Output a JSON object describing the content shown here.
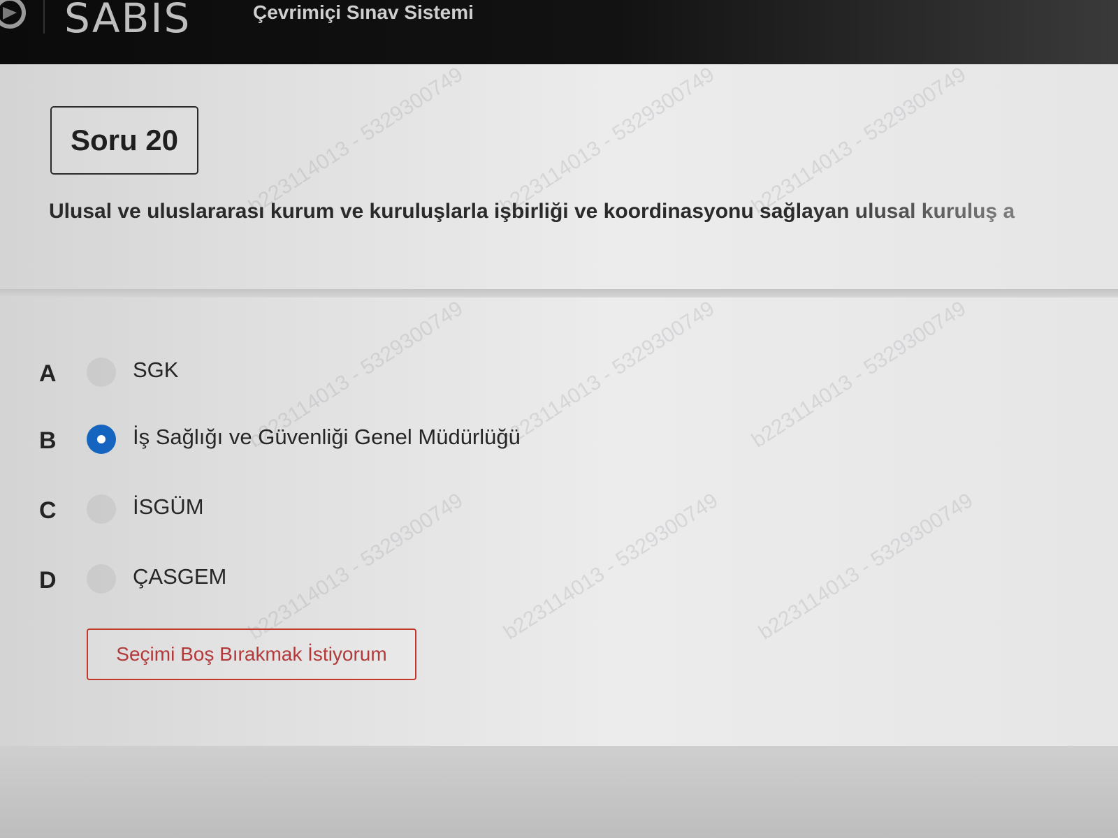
{
  "header": {
    "brand": "SABİS",
    "subtitle": "Çevrimiçi Sınav Sistemi"
  },
  "question": {
    "number_label": "Soru 20",
    "text": "Ulusal ve uluslararası kurum ve kuruluşlarla işbirliği ve koordinasyonu sağlayan ulusal kuruluş a"
  },
  "options": [
    {
      "letter": "A",
      "label": "SGK",
      "selected": false
    },
    {
      "letter": "B",
      "label": "İş Sağlığı ve Güvenliği Genel Müdürlüğü",
      "selected": true
    },
    {
      "letter": "C",
      "label": "İSGÜM",
      "selected": false
    },
    {
      "letter": "D",
      "label": "ÇASGEM",
      "selected": false
    }
  ],
  "blank_button": {
    "label": "Seçimi Boş Bırakmak İstiyorum"
  },
  "watermark": {
    "text": "b223114013 - 5329300749"
  },
  "colors": {
    "selected_radio": "#1565c0",
    "blank_button_border": "#c0392b"
  }
}
